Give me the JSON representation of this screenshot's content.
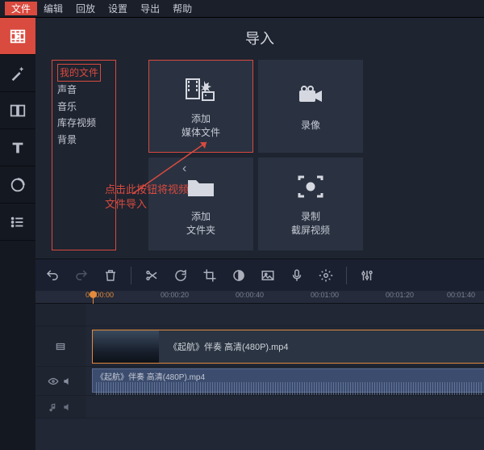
{
  "menu": {
    "file": "文件",
    "edit": "编辑",
    "playback": "回放",
    "settings": "设置",
    "export": "导出",
    "help": "帮助"
  },
  "import": {
    "title": "导入",
    "categories": {
      "myfiles": "我的文件",
      "sound": "声音",
      "music": "音乐",
      "stock": "库存视频",
      "bg": "背景"
    },
    "tiles": {
      "add_media": {
        "l1": "添加",
        "l2": "媒体文件"
      },
      "record": {
        "l1": "录像"
      },
      "add_folder": {
        "l1": "添加",
        "l2": "文件夹"
      },
      "screencast": {
        "l1": "录制",
        "l2": "截屏视频"
      }
    },
    "hint_l1": "点击此按钮将视频",
    "hint_l2": "文件导入"
  },
  "ruler": {
    "t0": "00:00:00",
    "t1": "00:00:20",
    "t2": "00:00:40",
    "t3": "00:01:00",
    "t4": "00:01:20",
    "t5": "00:01:40"
  },
  "clipName": "《起航》伴奏 高清(480P).mp4",
  "activeTime": "00:00:00"
}
